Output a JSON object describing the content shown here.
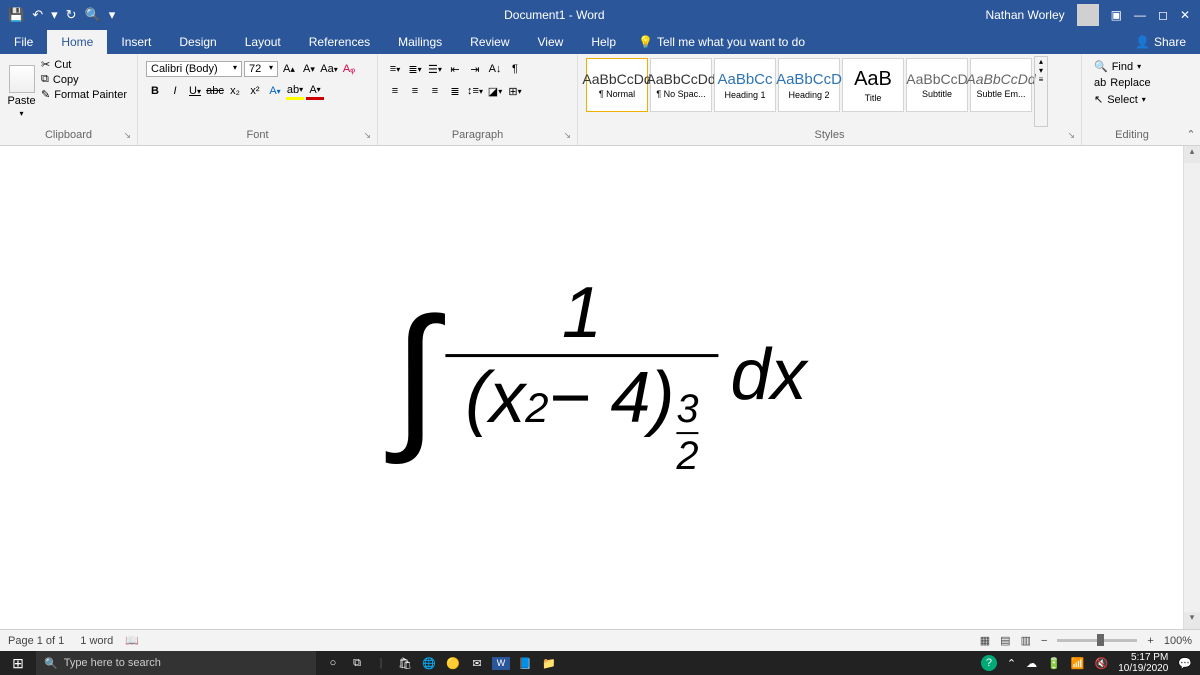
{
  "titlebar": {
    "title": "Document1 - Word",
    "user": "Nathan Worley"
  },
  "tabs": [
    "File",
    "Home",
    "Insert",
    "Design",
    "Layout",
    "References",
    "Mailings",
    "Review",
    "View",
    "Help"
  ],
  "active_tab": "Home",
  "tellme": "Tell me what you want to do",
  "share": "Share",
  "clipboard": {
    "paste": "Paste",
    "cut": "Cut",
    "copy": "Copy",
    "format_painter": "Format Painter",
    "label": "Clipboard"
  },
  "font": {
    "name": "Calibri (Body)",
    "size": "72",
    "label": "Font",
    "bold": "B",
    "italic": "I",
    "underline": "U",
    "strike": "abc",
    "sub": "x₂",
    "sup": "x²",
    "grow": "A",
    "shrink": "A",
    "case": "Aa",
    "clear": "A",
    "highlight": "ab",
    "color": "A"
  },
  "paragraph": {
    "label": "Paragraph"
  },
  "styles": {
    "label": "Styles",
    "items": [
      {
        "sample": "AaBbCcDd",
        "name": "¶ Normal"
      },
      {
        "sample": "AaBbCcDd",
        "name": "¶ No Spac..."
      },
      {
        "sample": "AaBbCc",
        "name": "Heading 1"
      },
      {
        "sample": "AaBbCcD",
        "name": "Heading 2"
      },
      {
        "sample": "AaB",
        "name": "Title"
      },
      {
        "sample": "AaBbCcD",
        "name": "Subtitle"
      },
      {
        "sample": "AaBbCcDd",
        "name": "Subtle Em..."
      }
    ]
  },
  "editing": {
    "find": "Find",
    "replace": "Replace",
    "select": "Select",
    "label": "Editing"
  },
  "equation": {
    "numerator": "1",
    "denom_base": "(x",
    "denom_exp": "2",
    "denom_rest": " − 4)",
    "outer_exp_num": "3",
    "outer_exp_den": "2",
    "dx": "dx"
  },
  "status": {
    "page": "Page 1 of 1",
    "words": "1 word",
    "zoom": "100%"
  },
  "taskbar": {
    "search": "Type here to search",
    "time": "5:17 PM",
    "date": "10/19/2020"
  }
}
